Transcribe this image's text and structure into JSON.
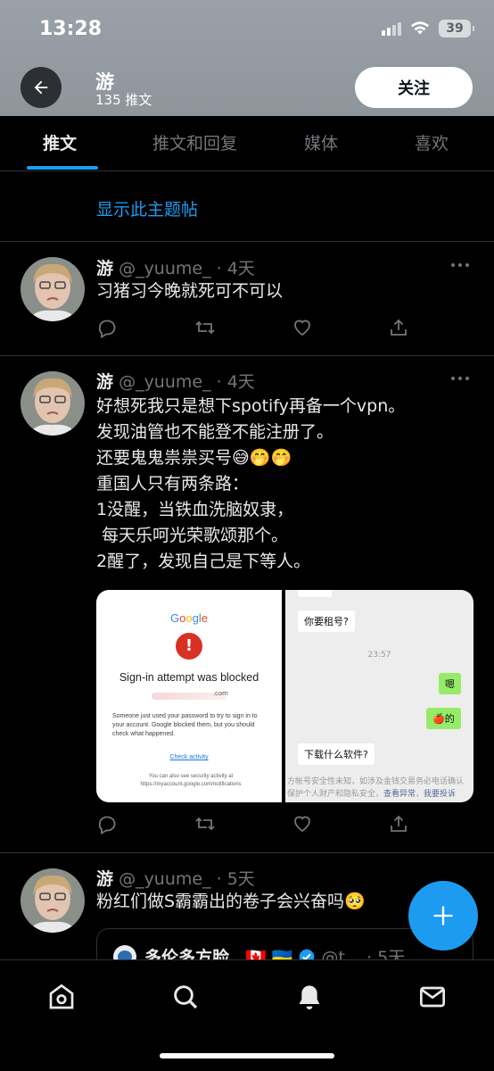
{
  "status_bar": {
    "time": "13:28",
    "battery": "39"
  },
  "header": {
    "name": "游",
    "tweet_count": "135 推文",
    "follow_label": "关注"
  },
  "tabs": [
    {
      "label": "推文",
      "active": true
    },
    {
      "label": "推文和回复",
      "active": false
    },
    {
      "label": "媒体",
      "active": false
    },
    {
      "label": "喜欢",
      "active": false
    }
  ],
  "show_thread": "显示此主题帖",
  "tweets": [
    {
      "name": "游",
      "meta": "@_yuume_ · 4天",
      "text": "习猪习今晚就死可不可以"
    },
    {
      "name": "游",
      "meta": "@_yuume_ · 4天",
      "text": "好想死我只是想下spotify再备一个vpn。\n发现油管也不能登不能注册了。\n还要鬼鬼祟祟买号😅🤭🤭\n重国人只有两条路：\n1没醒，当铁血洗脑奴隶，\n 每天乐呵光荣歌颂那个。\n2醒了，发现自己是下等人。",
      "media": {
        "google": {
          "logo": "Google",
          "title": "Sign-in attempt was blocked",
          "blurred_email_suffix": ".com",
          "body": "Someone just used your password to try to sign in to your account. Google blocked them, but you should check what happened.",
          "link": "Check activity",
          "footer": "You can also see security activity at https://myaccount.google.com/notifications"
        },
        "chat": {
          "msg1": "你要租号?",
          "time": "23:57",
          "msg2": "嗯",
          "msg3": "🍎的",
          "msg4": "下载什么软件?",
          "notice_line1": "方帐号安全性未知，如涉及金钱交易务必电话确认",
          "notice_line2_pre": "保护个人财产和隐私安全，",
          "notice_link1": "查看异常",
          "notice_line2_mid": "，",
          "notice_link2": "我要投诉"
        }
      }
    },
    {
      "name": "游",
      "meta": "@_yuume_ · 5天",
      "text": "粉红们做S霸霸出的卷子会兴奋吗🥺",
      "quote": {
        "name": "多伦多方脸",
        "flags": "🇨🇦 🇺🇦",
        "handle": "@t...",
        "time": "· 5天"
      }
    }
  ],
  "colors": {
    "accent": "#1d9bf0",
    "background": "#000000",
    "muted": "#71767b"
  },
  "icons": [
    "back-arrow-icon",
    "reply-icon",
    "retweet-icon",
    "like-icon",
    "share-icon",
    "compose-plus-icon",
    "home-icon",
    "search-icon",
    "notifications-icon",
    "messages-icon"
  ]
}
